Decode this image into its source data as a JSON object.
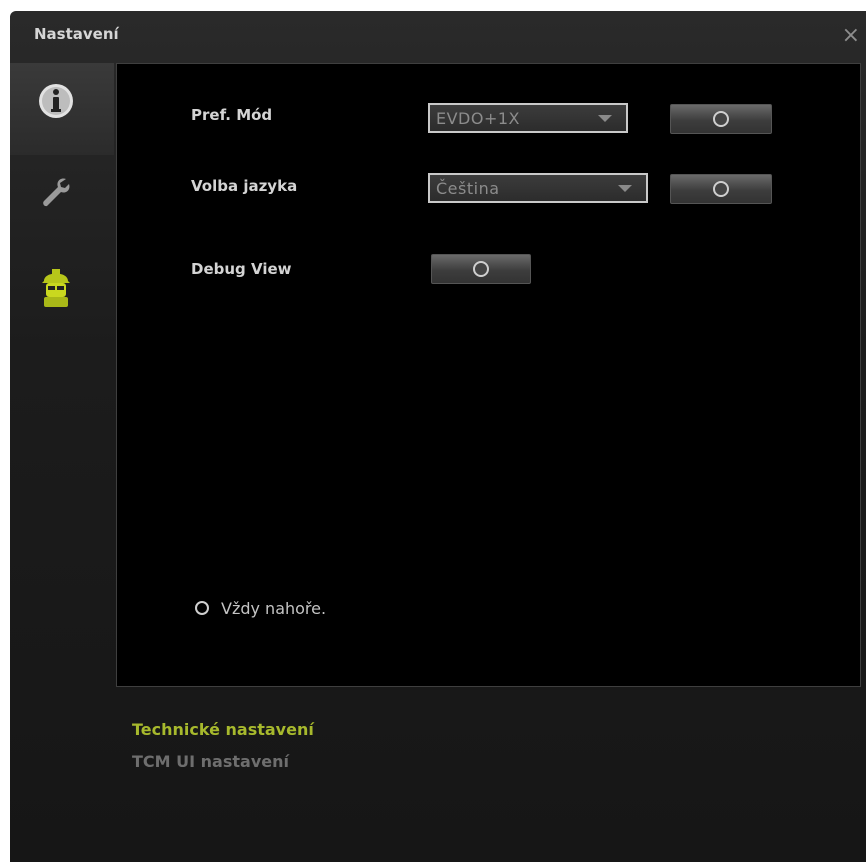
{
  "window": {
    "title": "Nastavení",
    "close_glyph": "×"
  },
  "sidebar": {
    "items": [
      {
        "icon": "info-icon",
        "active": true
      },
      {
        "icon": "wrench-icon",
        "active": false
      },
      {
        "icon": "technician-icon",
        "active": false
      }
    ]
  },
  "settings": {
    "pref_mode": {
      "label": "Pref. Mód",
      "value": "EVDO+1X"
    },
    "language": {
      "label": "Volba jazyka",
      "value": "Čeština"
    },
    "debug_view": {
      "label": "Debug View"
    }
  },
  "always_on_top": {
    "label": "Vždy nahoře."
  },
  "nav": {
    "technical": {
      "label": "Technické nastavení",
      "color": "#a7b92d"
    },
    "tcm_ui": {
      "label": "TCM UI nastavení",
      "color": "#6e6e6e"
    }
  },
  "colors": {
    "accent": "#b8c81a",
    "panel_bg": "#000000",
    "window_bg": "#1e1e1e"
  }
}
